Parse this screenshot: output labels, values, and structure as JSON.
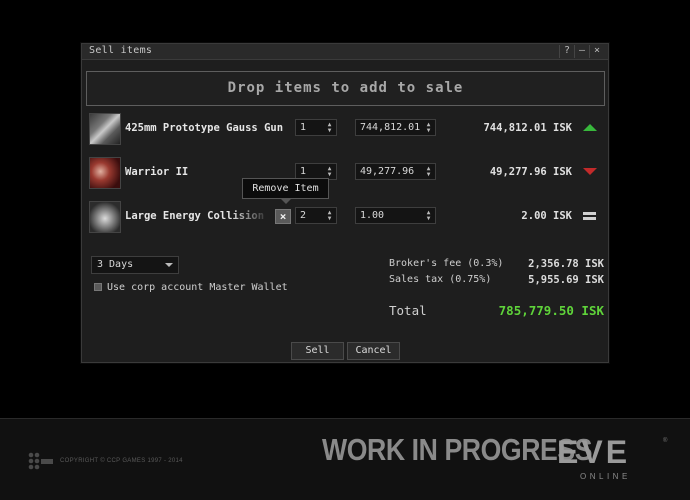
{
  "window": {
    "title": "Sell items",
    "buttons": {
      "help": "?",
      "minimize": "–",
      "close": "×"
    }
  },
  "drop_zone": {
    "text": "Drop items to add to sale"
  },
  "items": [
    {
      "name": "425mm Prototype Gauss Gun",
      "quantity": "1",
      "price": "744,812.01",
      "total": "744,812.01 ISK",
      "trend": "up",
      "icon": "gauss-gun-icon"
    },
    {
      "name": "Warrior II",
      "quantity": "1",
      "price": "49,277.96",
      "total": "49,277.96 ISK",
      "trend": "down",
      "icon": "drone-icon"
    },
    {
      "name": "Large Energy Collision Accelerator",
      "quantity": "2",
      "price": "1.00",
      "total": "2.00 ISK",
      "trend": "equal",
      "icon": "ammo-icon"
    }
  ],
  "tooltip": {
    "text": "Remove Item"
  },
  "remove_button": {
    "symbol": "×"
  },
  "duration": {
    "selected": "3 Days"
  },
  "corp_wallet": {
    "label": "Use corp account Master Wallet",
    "checked": false
  },
  "fees": {
    "broker_label": "Broker's fee (0.3%)",
    "broker_value": "2,356.78 ISK",
    "tax_label": "Sales tax (0.75%)",
    "tax_value": "5,955.69 ISK"
  },
  "totals": {
    "label": "Total",
    "value": "785,779.50 ISK"
  },
  "actions": {
    "sell": "Sell",
    "cancel": "Cancel"
  },
  "footer": {
    "copyright": "COPYRIGHT © CCP GAMES 1997 - 2014",
    "banner": "WORK IN PROGRESS",
    "logo_text": "EVE",
    "logo_sub": "ONLINE",
    "trademark": "®"
  },
  "colors": {
    "trend_up": "#38b83c",
    "trend_down": "#c22a2a",
    "grand_total": "#5fd33a"
  }
}
